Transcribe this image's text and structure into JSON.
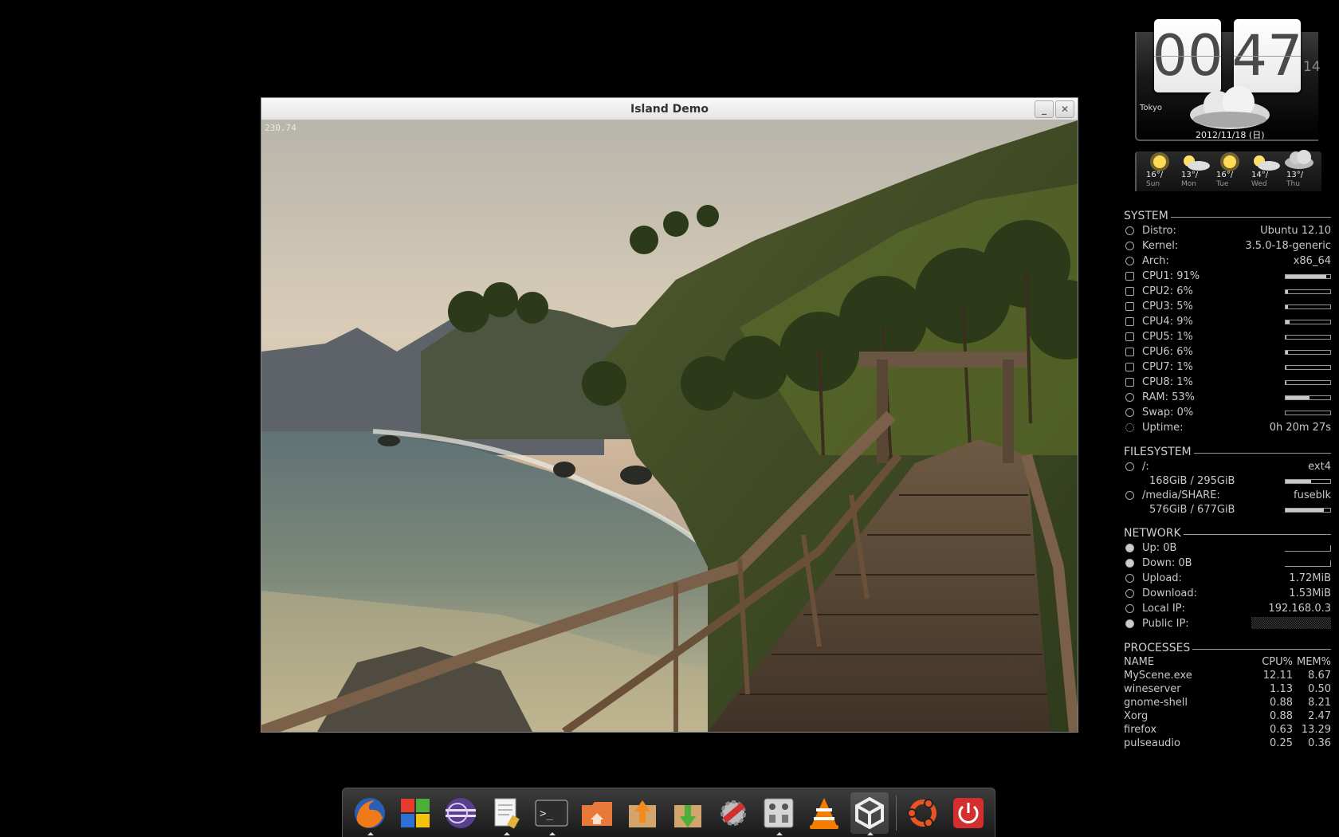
{
  "window": {
    "title": "Island Demo",
    "fps": "230.74",
    "minimize_label": "_",
    "close_label": "✕"
  },
  "clock": {
    "hours": "00",
    "minutes": "47",
    "seconds": "14",
    "city": "Tokyo",
    "date": "2012/11/18 (日)",
    "weather_icon": "cloud-icon"
  },
  "forecast": [
    {
      "temp": "16°/",
      "day": "Sun",
      "icon": "sun-icon"
    },
    {
      "temp": "13°/",
      "day": "Mon",
      "icon": "sun-cloud-icon"
    },
    {
      "temp": "16°/",
      "day": "Tue",
      "icon": "sun-icon"
    },
    {
      "temp": "14°/",
      "day": "Wed",
      "icon": "sun-cloud-icon"
    },
    {
      "temp": "13°/",
      "day": "Thu",
      "icon": "cloud-icon"
    }
  ],
  "system": {
    "heading": "SYSTEM",
    "distro_label": "Distro:",
    "distro": "Ubuntu 12.10",
    "kernel_label": "Kernel:",
    "kernel": "3.5.0-18-generic",
    "arch_label": "Arch:",
    "arch": "x86_64",
    "cpus": [
      {
        "label": "CPU1: 91%",
        "level": 0.91
      },
      {
        "label": "CPU2: 6%",
        "level": 0.06
      },
      {
        "label": "CPU3: 5%",
        "level": 0.05
      },
      {
        "label": "CPU4: 9%",
        "level": 0.09
      },
      {
        "label": "CPU5: 1%",
        "level": 0.01
      },
      {
        "label": "CPU6: 6%",
        "level": 0.06
      },
      {
        "label": "CPU7: 1%",
        "level": 0.01
      },
      {
        "label": "CPU8: 1%",
        "level": 0.01
      }
    ],
    "ram_label": "RAM: 53%",
    "ram_level": 0.53,
    "swap_label": "Swap: 0%",
    "swap_level": 0.0,
    "uptime_label": "Uptime:",
    "uptime": "0h 20m 27s"
  },
  "filesystem": {
    "heading": "FILESYSTEM",
    "mounts": [
      {
        "path": "/:",
        "type": "ext4",
        "usage": "168GiB / 295GiB",
        "level": 0.57
      },
      {
        "path": "/media/SHARE:",
        "type": "fuseblk",
        "usage": "576GiB / 677GiB",
        "level": 0.85
      }
    ]
  },
  "network": {
    "heading": "NETWORK",
    "up_label": "Up: 0B",
    "down_label": "Down: 0B",
    "upload_label": "Upload:",
    "upload": "1.72MiB",
    "download_label": "Download:",
    "download": "1.53MiB",
    "local_ip_label": "Local IP:",
    "local_ip": "192.168.0.3",
    "public_ip_label": "Public IP:"
  },
  "processes": {
    "heading": "PROCESSES",
    "columns": [
      "NAME",
      "CPU%",
      "MEM%"
    ],
    "rows": [
      [
        "MyScene.exe",
        "12.11",
        "8.67"
      ],
      [
        "wineserver",
        "1.13",
        "0.50"
      ],
      [
        "gnome-shell",
        "0.88",
        "8.21"
      ],
      [
        "Xorg",
        "0.88",
        "2.47"
      ],
      [
        "firefox",
        "0.63",
        "13.29"
      ],
      [
        "pulseaudio",
        "0.25",
        "0.36"
      ]
    ]
  },
  "dock": {
    "items": [
      {
        "icon": "firefox-icon",
        "running": true
      },
      {
        "icon": "windows-logo-icon",
        "running": false
      },
      {
        "icon": "eclipse-icon",
        "running": false
      },
      {
        "icon": "text-editor-icon",
        "running": true
      },
      {
        "icon": "terminal-icon",
        "running": true
      },
      {
        "icon": "home-folder-icon",
        "running": false
      },
      {
        "icon": "upload-box-icon",
        "running": false
      },
      {
        "icon": "download-box-icon",
        "running": false
      },
      {
        "icon": "settings-tools-icon",
        "running": false
      },
      {
        "icon": "mixer-icon",
        "running": true
      },
      {
        "icon": "vlc-icon",
        "running": false
      },
      {
        "icon": "unity-icon",
        "running": true
      },
      {
        "icon": "ubuntu-icon",
        "running": false
      },
      {
        "icon": "power-icon",
        "running": false
      }
    ]
  }
}
